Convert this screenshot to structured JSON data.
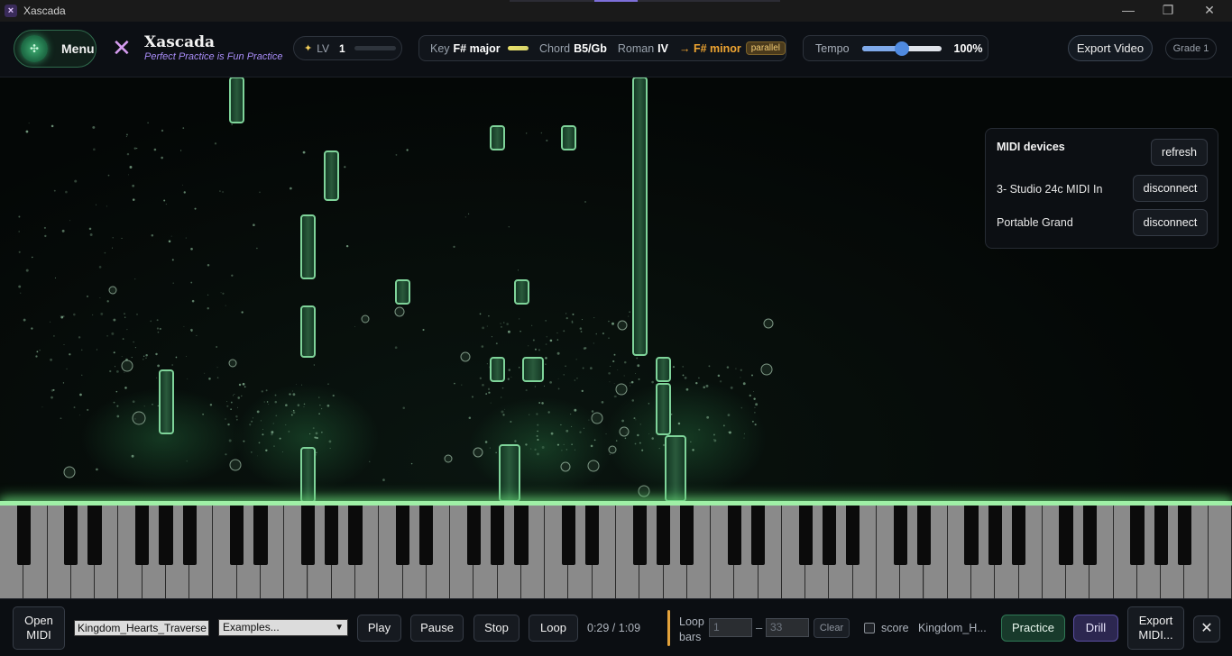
{
  "window": {
    "title": "Xascada",
    "minimize": "—",
    "restore": "❐",
    "close": "✕"
  },
  "header": {
    "menu_label": "Menu",
    "brand_mark": "✕",
    "brand_name": "Xascada",
    "brand_tagline": "Perfect Practice is Fun Practice",
    "level": {
      "icon": "✦",
      "label": "LV",
      "value": "1"
    },
    "key": {
      "key_label": "Key",
      "key_value": "F# major",
      "chord_label": "Chord",
      "chord_value": "B5/Gb",
      "roman_label": "Roman",
      "roman_value": "IV",
      "related": "→ F# minor",
      "related_badge": "parallel"
    },
    "tempo": {
      "label": "Tempo",
      "value": "100%",
      "level": 0.5
    },
    "export_video": "Export Video",
    "grade": "Grade 1"
  },
  "midi_panel": {
    "title": "MIDI devices",
    "refresh": "refresh",
    "devices": [
      {
        "name": "3- Studio 24c MIDI In",
        "action": "disconnect"
      },
      {
        "name": "Portable Grand",
        "action": "disconnect"
      }
    ]
  },
  "colors": {
    "note_fill": "#0f2a1a",
    "note_stroke": "#7fd49a",
    "glow": "#9ff0a6",
    "accent_purple": "#a88cf7",
    "accent_orange": "#f0a531"
  },
  "bottom": {
    "open_midi": "Open MIDI",
    "file_value": "Kingdom_Hearts_Traverse",
    "examples": "Examples...",
    "play": "Play",
    "pause": "Pause",
    "stop": "Stop",
    "loop": "Loop",
    "time": "0:29 / 1:09",
    "loop_bars": "Loop bars",
    "loop_start_placeholder": "1",
    "loop_dash": "–",
    "loop_end_placeholder": "33",
    "clear": "Clear",
    "score": "score",
    "song_short": "Kingdom_H...",
    "practice": "Practice",
    "drill": "Drill",
    "export_midi": "Export MIDI...",
    "close": "✕"
  }
}
